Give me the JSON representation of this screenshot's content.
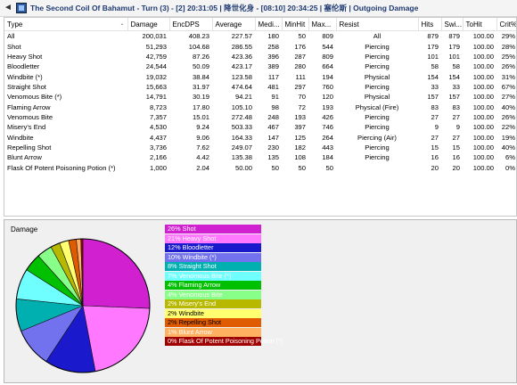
{
  "window": {
    "back_glyph": "◄",
    "title": "The Second Coil Of Bahamut - Turn (3) - [2] 20:31:05 | 降世化身 - [08:10] 20:34:25 | 塞伦斯 | Outgoing Damage"
  },
  "table": {
    "columns": [
      "Type",
      "Damage",
      "EncDPS",
      "Average",
      "Medi...",
      "MinHit",
      "Max...",
      "Resist",
      "Hits",
      "Swi...",
      "ToHit",
      "Crit%"
    ],
    "rows": [
      [
        "All",
        "200,031",
        "408.23",
        "227.57",
        "180",
        "50",
        "809",
        "All",
        "879",
        "879",
        "100.00",
        "29%"
      ],
      [
        "Shot",
        "51,293",
        "104.68",
        "286.55",
        "258",
        "176",
        "544",
        "Piercing",
        "179",
        "179",
        "100.00",
        "28%"
      ],
      [
        "Heavy Shot",
        "42,759",
        "87.26",
        "423.36",
        "396",
        "287",
        "809",
        "Piercing",
        "101",
        "101",
        "100.00",
        "25%"
      ],
      [
        "Bloodletter",
        "24,544",
        "50.09",
        "423.17",
        "389",
        "280",
        "664",
        "Piercing",
        "58",
        "58",
        "100.00",
        "26%"
      ],
      [
        "Windbite (*)",
        "19,032",
        "38.84",
        "123.58",
        "117",
        "111",
        "194",
        "Physical",
        "154",
        "154",
        "100.00",
        "31%"
      ],
      [
        "Straight Shot",
        "15,663",
        "31.97",
        "474.64",
        "481",
        "297",
        "760",
        "Piercing",
        "33",
        "33",
        "100.00",
        "67%"
      ],
      [
        "Venomous Bite (*)",
        "14,791",
        "30.19",
        "94.21",
        "91",
        "70",
        "120",
        "Physical",
        "157",
        "157",
        "100.00",
        "27%"
      ],
      [
        "Flaming Arrow",
        "8,723",
        "17.80",
        "105.10",
        "98",
        "72",
        "193",
        "Physical (Fire)",
        "83",
        "83",
        "100.00",
        "40%"
      ],
      [
        "Venomous Bite",
        "7,357",
        "15.01",
        "272.48",
        "248",
        "193",
        "426",
        "Piercing",
        "27",
        "27",
        "100.00",
        "26%"
      ],
      [
        "Misery's End",
        "4,530",
        "9.24",
        "503.33",
        "467",
        "397",
        "746",
        "Piercing",
        "9",
        "9",
        "100.00",
        "22%"
      ],
      [
        "Windbite",
        "4,437",
        "9.06",
        "164.33",
        "147",
        "125",
        "264",
        "Piercing (Air)",
        "27",
        "27",
        "100.00",
        "19%"
      ],
      [
        "Repelling Shot",
        "3,736",
        "7.62",
        "249.07",
        "230",
        "182",
        "443",
        "Piercing",
        "15",
        "15",
        "100.00",
        "40%"
      ],
      [
        "Blunt Arrow",
        "2,166",
        "4.42",
        "135.38",
        "135",
        "108",
        "184",
        "Piercing",
        "16",
        "16",
        "100.00",
        "6%"
      ],
      [
        "Flask Of Potent Poisoning Potion     (*)",
        "1,000",
        "2.04",
        "50.00",
        "50",
        "50",
        "50",
        "",
        "20",
        "20",
        "100.00",
        "0%"
      ]
    ]
  },
  "lower_panel": {
    "pie_label": "Damage"
  },
  "chart_data": {
    "type": "pie",
    "title": "Damage",
    "slices": [
      {
        "label": "26% Shot",
        "value": 51293,
        "color": "#d020d0"
      },
      {
        "label": "21% Heavy Shot",
        "value": 42759,
        "color": "#ff78ff"
      },
      {
        "label": "12% Bloodletter",
        "value": 24544,
        "color": "#1a1acc"
      },
      {
        "label": "10% Windbite (*)",
        "value": 19032,
        "color": "#7272ee"
      },
      {
        "label": "8% Straight Shot",
        "value": 15663,
        "color": "#00b0b0"
      },
      {
        "label": "7% Venomous Bite (*)",
        "value": 14791,
        "color": "#70ffff"
      },
      {
        "label": "4% Flaming Arrow",
        "value": 8723,
        "color": "#00c000"
      },
      {
        "label": "4% Venomous Bite",
        "value": 7357,
        "color": "#88ff88"
      },
      {
        "label": "2% Misery's End",
        "value": 4530,
        "color": "#b8b800"
      },
      {
        "label": "2% Windbite",
        "value": 4437,
        "color": "#ffff70"
      },
      {
        "label": "2% Repelling Shot",
        "value": 3736,
        "color": "#e05a00"
      },
      {
        "label": "1% Blunt Arrow",
        "value": 2166,
        "color": "#ffb060"
      },
      {
        "label": "0%  Flask Of Potent Poisoning Potion (*)",
        "value": 1000,
        "color": "#a00000"
      }
    ],
    "legend_text_colors": [
      "#ffffff",
      "#ffffff",
      "#ffffff",
      "#ffffff",
      "#ffffff",
      "#ffffff",
      "#ffffff",
      "#ffffff",
      "#ffffff",
      "#000000",
      "#000000",
      "#ffffff",
      "#ffffff"
    ]
  }
}
